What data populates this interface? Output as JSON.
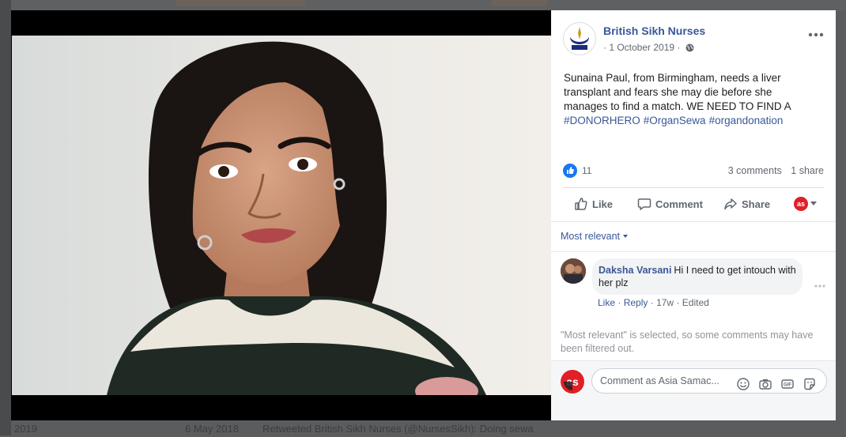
{
  "background": {
    "bottom_year": "2019",
    "bottom_date": "6 May 2018",
    "bottom_text": "Retweeted British Sikh Nurses (@NursesSikh): Doing sewa"
  },
  "post": {
    "page_name": "British Sikh Nurses",
    "date": "· 1 October 2019 ·",
    "text": "Sunaina Paul, from Birmingham, needs a liver transplant and fears she may die before she manages to find a match. WE NEED TO FIND A",
    "hashtags": [
      "#DONORHERO",
      "#OrganSewa",
      "#organdonation"
    ],
    "reaction_count": "11",
    "comments_count": "3 comments",
    "shares_count": "1 share"
  },
  "actions": {
    "like": "Like",
    "comment": "Comment",
    "share": "Share",
    "profile_initials": "as"
  },
  "comments_section": {
    "sort_label": "Most relevant",
    "comments": [
      {
        "author": "Daksha Varsani",
        "text": "Hi I need to get intouch with her plz",
        "like": "Like",
        "reply": "Reply",
        "time": "17w",
        "edited": "Edited"
      }
    ],
    "filter_note": "\"Most relevant\" is selected, so some comments may have been filtered out.",
    "input_placeholder": "Comment as Asia Samac..."
  },
  "colors": {
    "link": "#385898",
    "like_blue": "#1877f2",
    "brand_red": "#e01f26"
  }
}
